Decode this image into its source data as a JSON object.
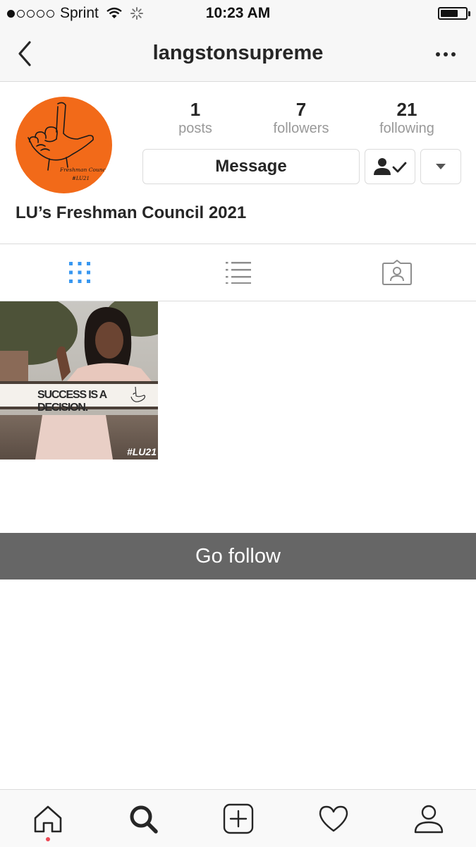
{
  "status_bar": {
    "carrier": "Sprint",
    "time": "10:23 AM",
    "signal_bars_filled": 1,
    "signal_bars_total": 5,
    "battery_level": 0.7
  },
  "header": {
    "username": "langstonsupreme",
    "back_icon": "chevron-left-icon",
    "more_icon": "ellipsis-icon"
  },
  "profile": {
    "posts_count": "1",
    "posts_label": "posts",
    "followers_count": "7",
    "followers_label": "followers",
    "following_count": "21",
    "following_label": "following",
    "message_label": "Message",
    "display_name": "LU’s Freshman Council 2021",
    "avatar_color": "#f26a19",
    "avatar_text_line1": "Freshman Council",
    "avatar_text_line2": "#LU21"
  },
  "tabs": [
    {
      "icon": "grid-icon",
      "active": true
    },
    {
      "icon": "list-icon",
      "active": false
    },
    {
      "icon": "tagged-icon",
      "active": false
    }
  ],
  "posts": [
    {
      "caption": "SUCCESS IS A DECISION.",
      "tag": "#LU21"
    }
  ],
  "banner": {
    "text": "Go follow"
  },
  "bottom_nav": [
    {
      "icon": "home-icon",
      "notification": true
    },
    {
      "icon": "search-icon",
      "notification": false
    },
    {
      "icon": "add-icon",
      "notification": false
    },
    {
      "icon": "heart-icon",
      "notification": false
    },
    {
      "icon": "profile-icon",
      "notification": false
    }
  ],
  "colors": {
    "accent_blue": "#3897f0",
    "notification_red": "#ed4956",
    "banner_gray": "#666666"
  }
}
